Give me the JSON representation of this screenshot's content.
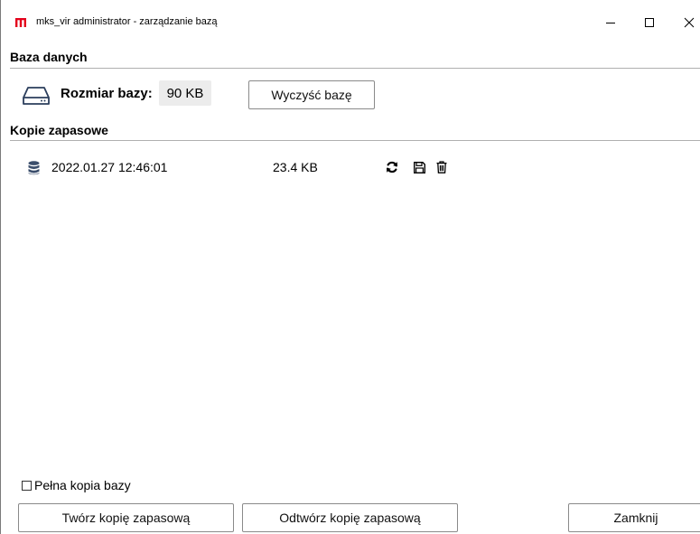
{
  "window": {
    "title": "mks_vir administrator - zarządzanie bazą",
    "logo_color": "#e3001b",
    "controls": {
      "minimize": "minimize-icon",
      "maximize": "maximize-icon",
      "close": "close-icon"
    }
  },
  "database": {
    "header": "Baza danych",
    "size_label": "Rozmiar bazy:",
    "size_value": "90 KB",
    "clear_button": "Wyczyść bazę"
  },
  "backups": {
    "header": "Kopie zapasowe",
    "items": [
      {
        "date": "2022.01.27 12:46:01",
        "size": "23.4 KB",
        "icon": "database-stack-icon",
        "actions": [
          "restore-icon",
          "save-icon",
          "delete-icon"
        ]
      }
    ]
  },
  "footer": {
    "full_backup_label": "Pełna kopia bazy",
    "full_backup_checked": false,
    "create_button": "Twórz kopię zapasową",
    "restore_button": "Odtwórz kopię zapasową",
    "close_button": "Zamknij"
  }
}
